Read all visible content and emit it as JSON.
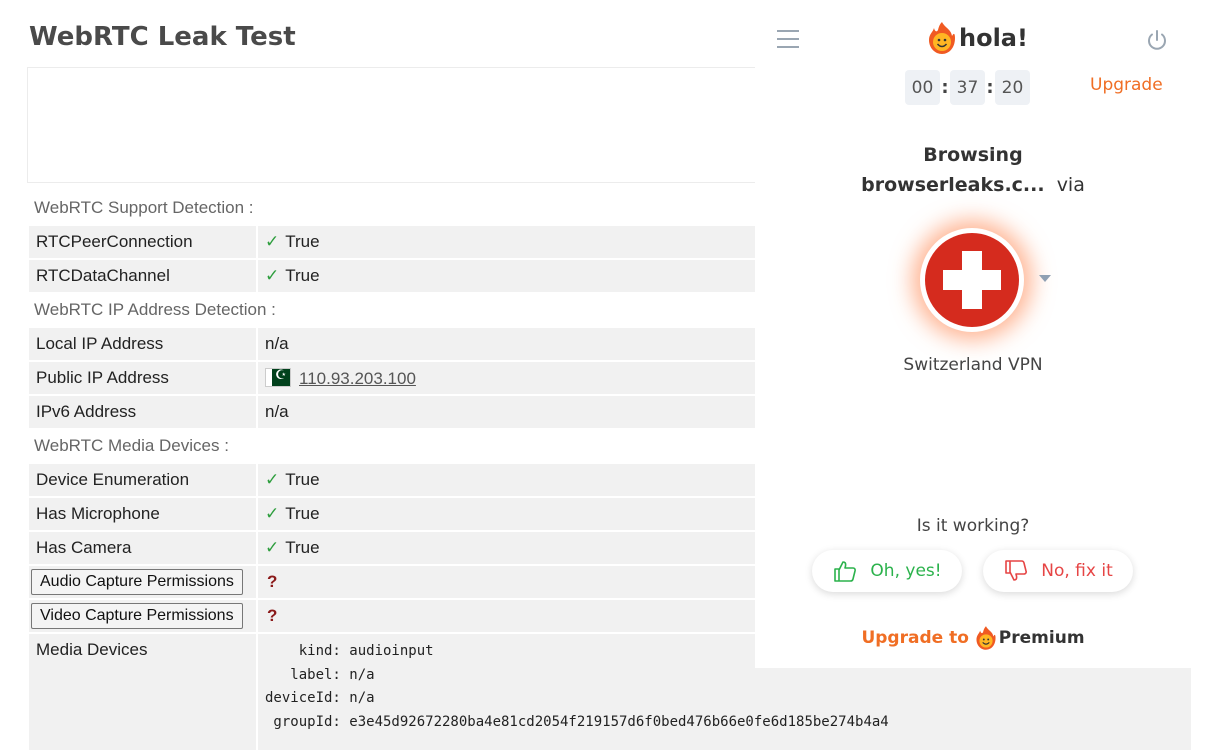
{
  "page": {
    "title": "WebRTC Leak Test",
    "sections": {
      "support": "WebRTC Support Detection :",
      "ip": "WebRTC IP Address Detection :",
      "media": "WebRTC Media Devices :"
    },
    "rows": {
      "rtc_peer": {
        "label": "RTCPeerConnection",
        "value": "True"
      },
      "rtc_data": {
        "label": "RTCDataChannel",
        "value": "True"
      },
      "local_ip": {
        "label": "Local IP Address",
        "value": "n/a"
      },
      "public_ip": {
        "label": "Public IP Address",
        "value": "110.93.203.100"
      },
      "ipv6": {
        "label": "IPv6 Address",
        "value": "n/a"
      },
      "dev_enum": {
        "label": "Device Enumeration",
        "value": "True"
      },
      "has_mic": {
        "label": "Has Microphone",
        "value": "True"
      },
      "has_cam": {
        "label": "Has Camera",
        "value": "True"
      },
      "audio_perm": {
        "label": "Audio Capture Permissions",
        "value": "?"
      },
      "video_perm": {
        "label": "Video Capture Permissions",
        "value": "?"
      },
      "media_devices": {
        "label": "Media Devices",
        "text": "    kind: audioinput\n   label: n/a\ndeviceId: n/a\n groupId: e3e45d92672280ba4e81cd2054f219157d6f0bed476b66e0fe6d185be274b4a4"
      }
    },
    "check_glyph": "✓"
  },
  "hola": {
    "brand": "hola!",
    "timer": {
      "hours": "00",
      "minutes": "37",
      "seconds": "20"
    },
    "upgrade": "Upgrade",
    "browsing": "Browsing",
    "site": "browserleaks.c...",
    "via": "via",
    "country": "Switzerland VPN",
    "question": "Is it working?",
    "yes": "Oh, yes!",
    "no": "No, fix it",
    "upgrade_to": "Upgrade to",
    "premium": "Premium",
    "colors": {
      "accent": "#f06e24",
      "yes": "#2bb24c",
      "no": "#e64545",
      "flag_red": "#d52b1e"
    },
    "icons": [
      "menu-icon",
      "power-icon",
      "hola-logo-icon",
      "switzerland-flag-icon",
      "thumbs-up-icon",
      "thumbs-down-icon"
    ]
  }
}
